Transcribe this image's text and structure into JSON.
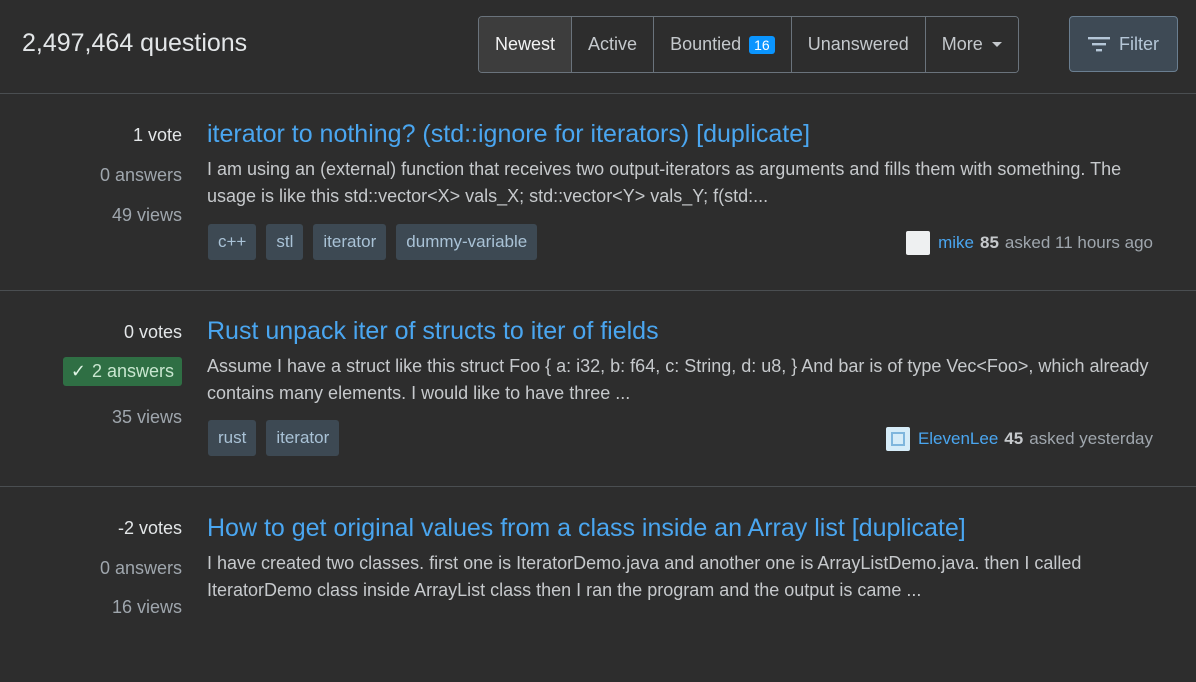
{
  "header": {
    "question_count": "2,497,464 questions",
    "tabs": [
      {
        "label": "Newest"
      },
      {
        "label": "Active"
      },
      {
        "label": "Bountied",
        "badge": "16"
      },
      {
        "label": "Unanswered"
      },
      {
        "label": "More"
      }
    ],
    "filter_label": "Filter"
  },
  "questions": [
    {
      "votes": "1 vote",
      "answers": "0 answers",
      "views": "49 views",
      "title": "iterator to nothing? (std::ignore for iterators) [duplicate]",
      "excerpt": "I am using an (external) function that receives two output-iterators as arguments and fills them with something. The usage is like this std::vector<X> vals_X; std::vector<Y> vals_Y; f(std:...",
      "tags": [
        "c++",
        "stl",
        "iterator",
        "dummy-variable"
      ],
      "user": "mike",
      "rep": "85",
      "time": "asked 11 hours ago"
    },
    {
      "votes": "0 votes",
      "answers": "2 answers",
      "views": "35 views",
      "title": "Rust unpack iter of structs to iter of fields",
      "excerpt": "Assume I have a struct like this struct Foo { a: i32, b: f64, c: String, d: u8, } And bar is of type Vec<Foo>, which already contains many elements. I would like to have three ...",
      "tags": [
        "rust",
        "iterator"
      ],
      "user": "ElevenLee",
      "rep": "45",
      "time": "asked yesterday"
    },
    {
      "votes": "-2 votes",
      "answers": "0 answers",
      "views": "16 views",
      "title": "How to get original values from a class inside an Array list [duplicate]",
      "excerpt": "I have created two classes. first one is IteratorDemo.java and another one is ArrayListDemo.java. then I called IteratorDemo class inside ArrayList class then I ran the program and the output is came ..."
    }
  ]
}
